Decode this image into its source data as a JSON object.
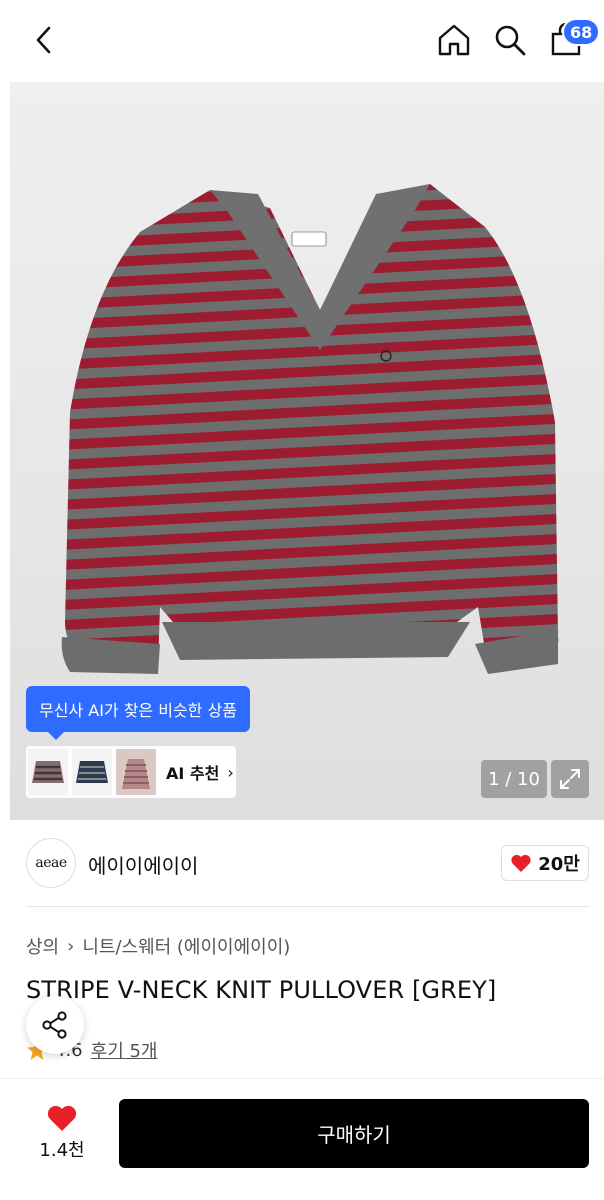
{
  "header": {
    "cart_badge": "68",
    "icons": [
      "chevron-left-icon",
      "home-icon",
      "search-icon",
      "shopping-bag-icon"
    ]
  },
  "gallery": {
    "ai_bubble": "무신사 AI가 찾은 비슷한 상품",
    "ai_recommend_label": "AI 추천",
    "ai_chevron": "›",
    "page_counter": "1 / 10",
    "brand_logo_text": "aeae"
  },
  "brand": {
    "logo_text": "aeae",
    "name": "에이이에이이",
    "likes": "20만"
  },
  "product": {
    "breadcrumb": [
      "상의",
      "니트/스웨터 (에이이에이이)"
    ],
    "breadcrumb_sep": "›",
    "title": "STRIPE V-NECK KNIT PULLOVER [GREY]",
    "rating": "4.6",
    "reviews": "후기 5개"
  },
  "bottom": {
    "wish_count": "1.4천",
    "buy_label": "구매하기"
  },
  "colors": {
    "accent": "#2f6bff",
    "heart": "#e8202a",
    "star": "#f5a623",
    "stripe_red": "#9c1c32",
    "stripe_grey": "#6b6b6b",
    "buy_bg": "#000000"
  }
}
